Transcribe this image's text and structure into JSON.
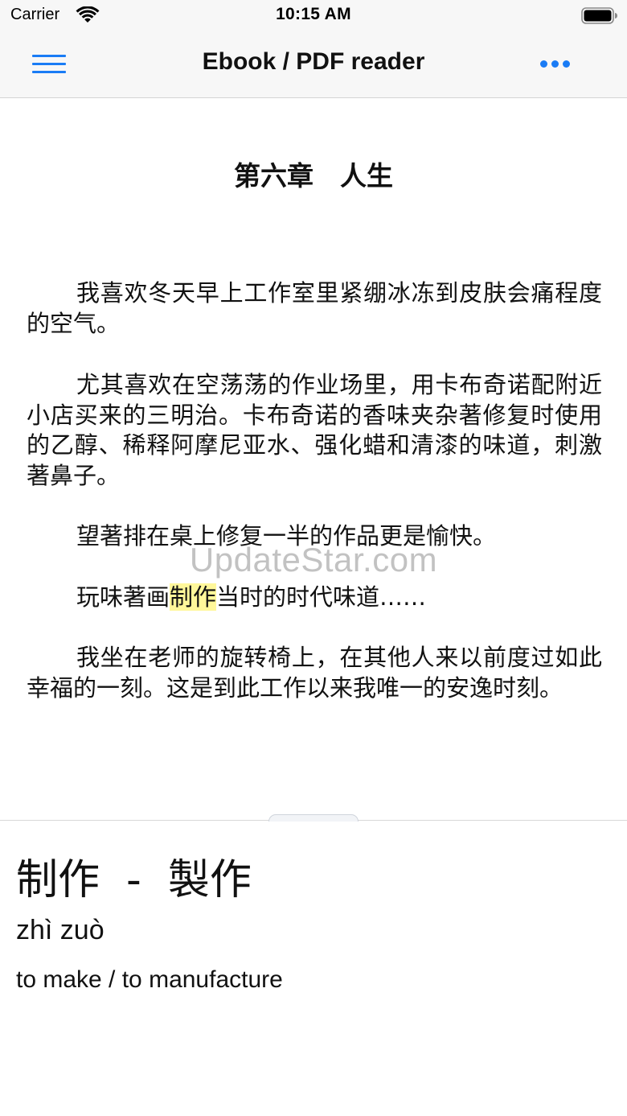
{
  "status_bar": {
    "carrier": "Carrier",
    "time": "10:15 AM"
  },
  "nav": {
    "title": "Ebook / PDF reader",
    "menu_icon": "hamburger-menu-icon",
    "more_icon": "more-ellipsis-icon",
    "accent_color": "#1a7cf5"
  },
  "book": {
    "chapter_title": "第六章　人生",
    "paragraphs": [
      "我喜欢冬天早上工作室里紧绷冰冻到皮肤会痛程度的空气。",
      "尤其喜欢在空荡荡的作业场里，用卡布奇诺配附近小店买来的三明治。卡布奇诺的香味夹杂著修复时使用的乙醇、稀释阿摩尼亚水、强化蜡和清漆的味道，刺激著鼻子。",
      "望著排在桌上修复一半的作品更是愉快。",
      "我坐在老师的旋转椅上，在其他人来以前度过如此幸福的一刻。这是到此工作以来我唯一的安逸时刻。"
    ],
    "highlight_paragraph": {
      "before": "玩味著画",
      "highlighted": "制作",
      "after": "当时的时代味道……"
    },
    "highlight_color": "#fff79a"
  },
  "watermark": "UpdateStar.com",
  "dictionary": {
    "headword": "制作  -  製作",
    "pinyin": "zhì zuò",
    "definition": "to make / to manufacture"
  }
}
